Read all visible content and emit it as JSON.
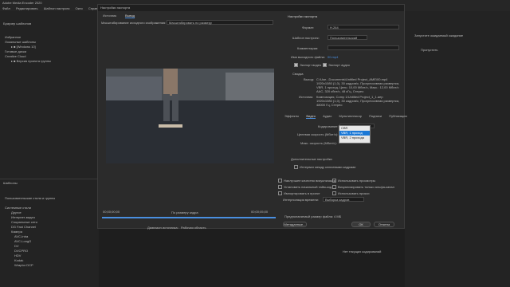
{
  "app": {
    "title": "Adobe Media Encoder 2020"
  },
  "menu": [
    "Файл",
    "Редактировать",
    "Шаблон настроек",
    "Окно",
    "Справка"
  ],
  "left_panel": {
    "header": "Браузер шаблонов",
    "items": [
      "Избранное",
      "Локальные шаблоны",
      "▸ ■ [Windows 10]",
      "Готовые диски",
      "Creative Cloud",
      "▸ ■ Версия проекта группы"
    ],
    "section2_header": "Шаблоны",
    "section2_items": [
      "Пользовательские стили и группы",
      "Системные стили",
      "Другое",
      "Интернет-видео",
      "Социальные сети",
      "DG Fast Channel",
      "Камера",
      "AVC-Intra",
      "AVC-LongG",
      "DV",
      "DVCPRO",
      "HDV",
      "Kodak",
      "Wraptor DCP"
    ]
  },
  "right_bg": {
    "line1": "Запустите ожидаемый ожидание",
    "line2": "Пропустить",
    "status": "Нет текущих кодирований"
  },
  "dialog": {
    "title": "Настройки экспорта",
    "tabs": [
      "Источник",
      "Вывод"
    ],
    "source_scale_label": "Масштабирование исходного изображения:",
    "source_scale_value": "Масштабировать по размеру",
    "export_settings_header": "Настройки экспорта",
    "format_label": "Формат:",
    "format_value": "H.264",
    "preset_label": "Шаблон настроек:",
    "preset_value": "Пользовательский",
    "comments_label": "Комментарии:",
    "output_name_label": "Имя выходного файла:",
    "output_name_value": "00.mp4",
    "export_video": "Экспорт видео",
    "export_audio": "Экспорт аудио",
    "summary_header": "Сводка",
    "output_label": "Выход:",
    "output_text": [
      "C:\\Use...Documents\\Untitled Project_AME\\00.mp4",
      "1920x1080 (1,0), 30 кадров/с, Прогрессивная развертка,",
      "VBR, 1 проход, Цель: 10,00 Мбит/с, Макс.: 12,00 Мбит/с",
      "AAC, 320 кбит/с, 48 кГц, Стерео"
    ],
    "source_label": "Источник:",
    "source_text": [
      "Композиция, Comp 1/Untitled Project_1_1.aep",
      "1920x1080 (1,0), 30 кадров/с, Прогрессивная развертка,",
      "48000 Гц, Стерео"
    ],
    "subtabs": [
      "Эффекты",
      "Видео",
      "Аудио",
      "Мультиплексор",
      "Подписи",
      "Публикация"
    ],
    "encoding_label": "Кодирование:",
    "encoding_value": "VBR, 1 проход",
    "target_bitrate_label": "Целевая скорость (Мбит/с):",
    "max_bitrate_label": "Макс. скорость (Мбит/с):",
    "advanced_header": "Дополнительные настройки",
    "keyframe_label": "Интервал между ключевыми кадрами",
    "dropdown_options": [
      "CBR",
      "VBR, 1 проход",
      "VBR, 2 прохода"
    ],
    "max_quality": "Наилучшее качество визуализации",
    "use_previews": "Использовать просмотры",
    "import_project": "Импортировать в проект",
    "use_proxies": "Использовать прокси",
    "start_timecode": "Установить начальный тайм-код",
    "render_alpha": "Визуализировать только альфа-канал",
    "time_interp_label": "Интерполяция времени:",
    "time_interp_value": "Выборка кадров",
    "file_size_label": "Предполагаемый размер файла:",
    "file_size_value": "4 МБ",
    "metadata_button": "Метаданные...",
    "ok_button": "ОК",
    "cancel_button": "Отмена",
    "timecode_start": "00;00;00;00",
    "timecode_end": "00;00;05;00",
    "fit_label": "По размеру кадра",
    "source_range_label": "Диапазон источника:",
    "source_range_value": "Рабочая область"
  },
  "colors": {
    "accent": "#4a8fe0",
    "dialog_bg": "#2b2b2b",
    "selection": "#1b78d6"
  }
}
